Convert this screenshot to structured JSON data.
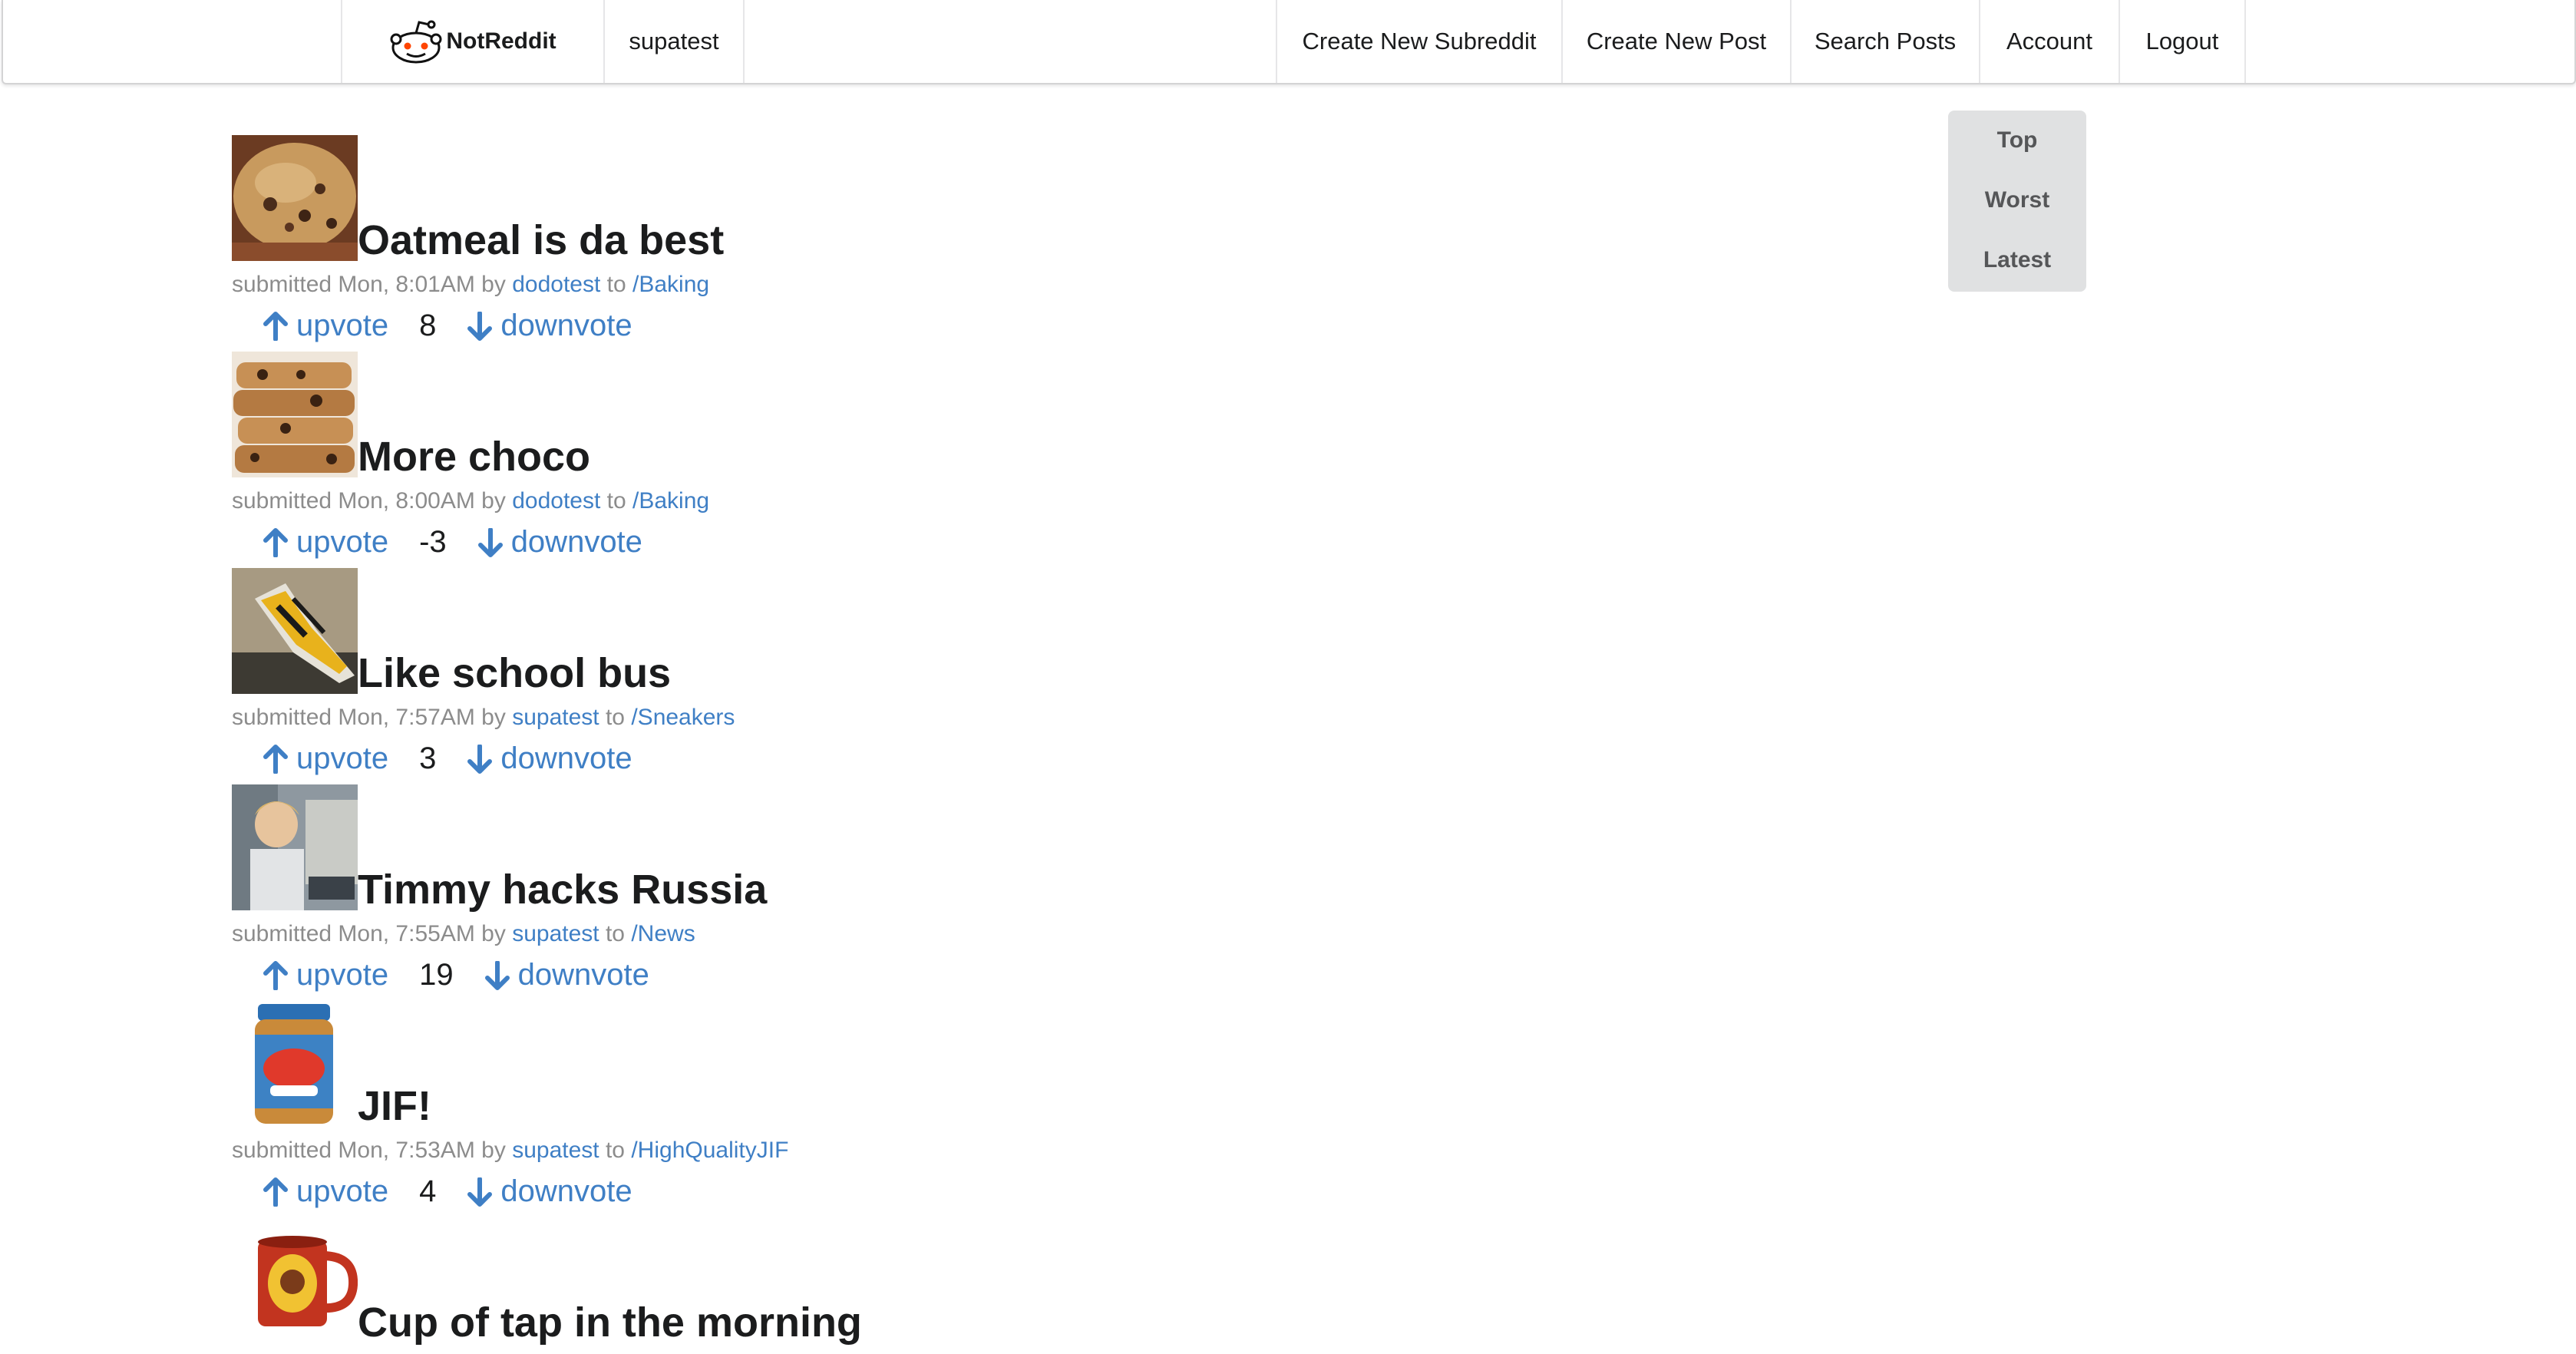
{
  "nav": {
    "brand": "NotReddit",
    "username": "supatest",
    "create_subreddit": "Create New Subreddit",
    "create_post": "Create New Post",
    "search_posts": "Search Posts",
    "account": "Account",
    "logout": "Logout"
  },
  "sort": {
    "top": "Top",
    "worst": "Worst",
    "latest": "Latest"
  },
  "vote_labels": {
    "upvote": "upvote",
    "downvote": "downvote"
  },
  "posts": [
    {
      "title": "Oatmeal is da best",
      "submitted": "submitted Mon, 8:01AM",
      "by": "by",
      "author": "dodotest",
      "to": "to",
      "subreddit": "/Baking",
      "score": "8",
      "thumbnail": "oatmeal-cookie-image"
    },
    {
      "title": "More choco",
      "submitted": "submitted Mon, 8:00AM",
      "by": "by",
      "author": "dodotest",
      "to": "to",
      "subreddit": "/Baking",
      "score": "-3",
      "thumbnail": "chocolate-cookie-stack-image"
    },
    {
      "title": "Like school bus",
      "submitted": "submitted Mon, 7:57AM",
      "by": "by",
      "author": "supatest",
      "to": "to",
      "subreddit": "/Sneakers",
      "score": "3",
      "thumbnail": "yellow-sneaker-image"
    },
    {
      "title": "Timmy hacks Russia",
      "submitted": "submitted Mon, 7:55AM",
      "by": "by",
      "author": "supatest",
      "to": "to",
      "subreddit": "/News",
      "score": "19",
      "thumbnail": "kid-at-computer-image"
    },
    {
      "title": "JIF!",
      "submitted": "submitted Mon, 7:53AM",
      "by": "by",
      "author": "supatest",
      "to": "to",
      "subreddit": "/HighQualityJIF",
      "score": "4",
      "thumbnail": "skippy-jar-image"
    },
    {
      "title": "Cup of tap in the morning",
      "thumbnail": "tapatio-mug-image"
    }
  ]
}
